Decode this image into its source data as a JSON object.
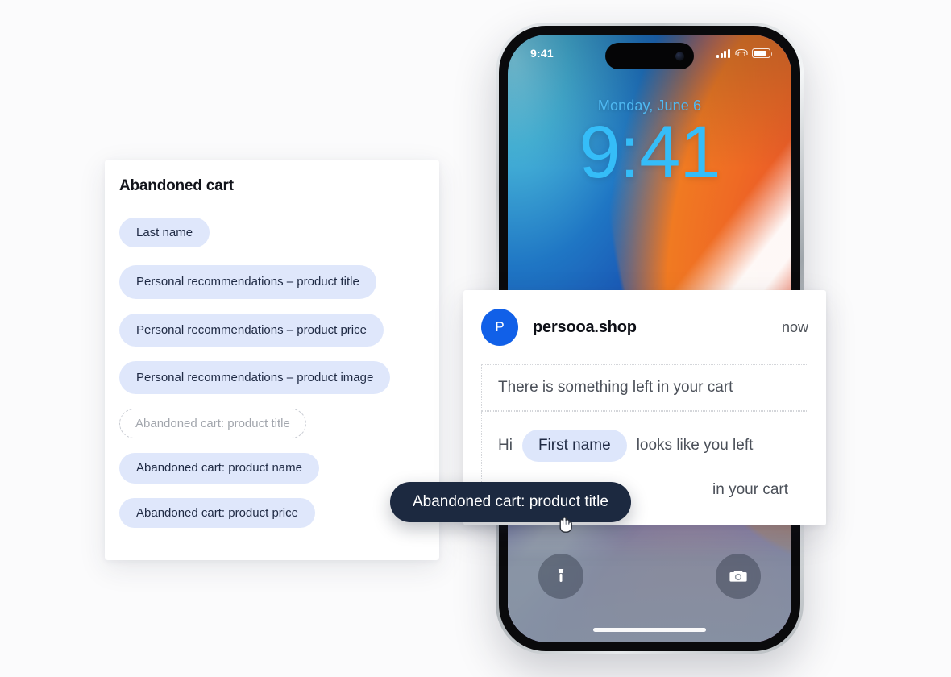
{
  "tokens_panel": {
    "title": "Abandoned cart",
    "chips": [
      {
        "label": "Last name",
        "state": "normal"
      },
      {
        "label": "Personal recommendations – product title",
        "state": "normal"
      },
      {
        "label": "Personal recommendations – product price",
        "state": "normal"
      },
      {
        "label": "Personal recommendations – product image",
        "state": "normal"
      },
      {
        "label": "Abandoned cart: product title",
        "state": "ghost"
      },
      {
        "label": "Abandoned cart: product name",
        "state": "normal"
      },
      {
        "label": "Abandoned cart: product price",
        "state": "normal"
      }
    ]
  },
  "drag": {
    "pill_label": "Abandoned cart: product title",
    "cursor": "grabbing-hand-cursor"
  },
  "phone": {
    "status_bar": {
      "time": "9:41",
      "icons": [
        "cellular-signal-icon",
        "wifi-icon",
        "battery-icon"
      ]
    },
    "lock_screen": {
      "date": "Monday, June 6",
      "time": "9:41"
    },
    "actions": {
      "left": "flashlight-icon",
      "right": "camera-icon"
    }
  },
  "notification": {
    "avatar_initial": "P",
    "app_name": "persooa.shop",
    "timestamp": "now",
    "title_dropzone": "There is something left in your cart",
    "body": {
      "part1": "Hi",
      "token": "First name",
      "part2": "looks like you left",
      "part3": "in your cart"
    }
  },
  "colors": {
    "chip_bg": "#dfe7fb",
    "chip_text": "#1f2a44",
    "drag_pill_bg": "#1c2940",
    "avatar_bg": "#1160e8",
    "lock_accent": "#35bdf8",
    "page_bg": "#fbfbfc"
  }
}
